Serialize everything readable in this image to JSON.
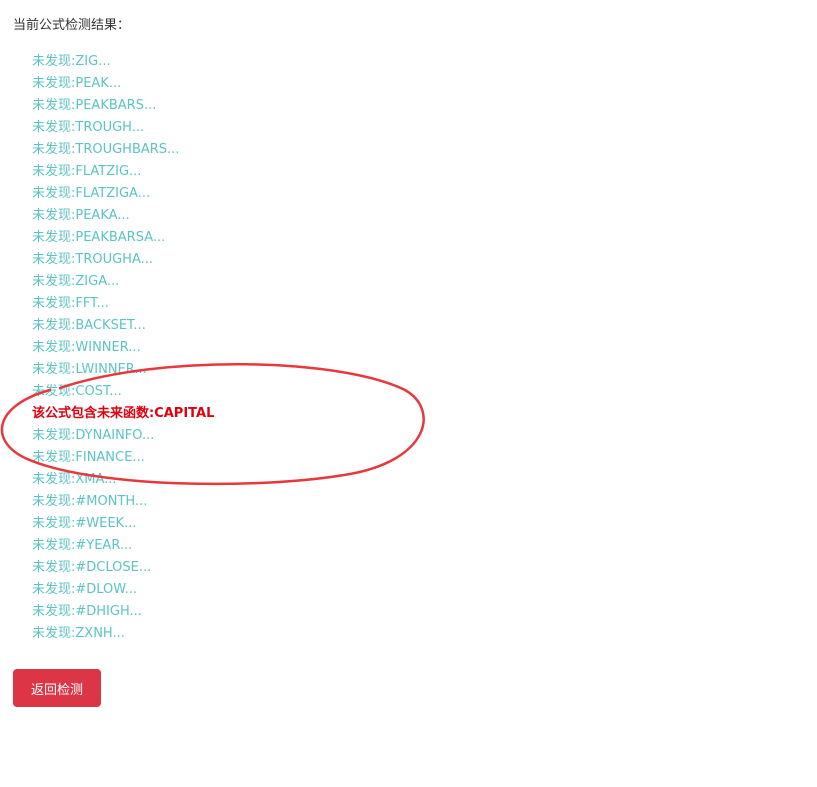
{
  "heading": "当前公式检测结果：",
  "results": [
    {
      "text": "未发现:ZIG...",
      "status": "ok"
    },
    {
      "text": "未发现:PEAK...",
      "status": "ok"
    },
    {
      "text": "未发现:PEAKBARS...",
      "status": "ok"
    },
    {
      "text": "未发现:TROUGH...",
      "status": "ok"
    },
    {
      "text": "未发现:TROUGHBARS...",
      "status": "ok"
    },
    {
      "text": "未发现:FLATZIG...",
      "status": "ok"
    },
    {
      "text": "未发现:FLATZIGA...",
      "status": "ok"
    },
    {
      "text": "未发现:PEAKA...",
      "status": "ok"
    },
    {
      "text": "未发现:PEAKBARSA...",
      "status": "ok"
    },
    {
      "text": "未发现:TROUGHA...",
      "status": "ok"
    },
    {
      "text": "未发现:ZIGA...",
      "status": "ok"
    },
    {
      "text": "未发现:FFT...",
      "status": "ok"
    },
    {
      "text": "未发现:BACKSET...",
      "status": "ok"
    },
    {
      "text": "未发现:WINNER...",
      "status": "ok"
    },
    {
      "text": "未发现:LWINNER...",
      "status": "ok"
    },
    {
      "text": "未发现:COST...",
      "status": "ok"
    },
    {
      "text": "该公式包含未来函数:CAPITAL",
      "status": "warning"
    },
    {
      "text": "未发现:DYNAINFO...",
      "status": "ok"
    },
    {
      "text": "未发现:FINANCE...",
      "status": "ok"
    },
    {
      "text": "未发现:XMA...",
      "status": "ok"
    },
    {
      "text": "未发现:#MONTH...",
      "status": "ok"
    },
    {
      "text": "未发现:#WEEK...",
      "status": "ok"
    },
    {
      "text": "未发现:#YEAR...",
      "status": "ok"
    },
    {
      "text": "未发现:#DCLOSE...",
      "status": "ok"
    },
    {
      "text": "未发现:#DLOW...",
      "status": "ok"
    },
    {
      "text": "未发现:#DHIGH...",
      "status": "ok"
    },
    {
      "text": "未发现:ZXNH...",
      "status": "ok"
    }
  ],
  "back_button": "返回检测",
  "colors": {
    "ok_text": "#5bc3c5",
    "warning_text": "#e0000f",
    "annotation_stroke": "#e8383d",
    "button_bg": "#dc3545"
  }
}
